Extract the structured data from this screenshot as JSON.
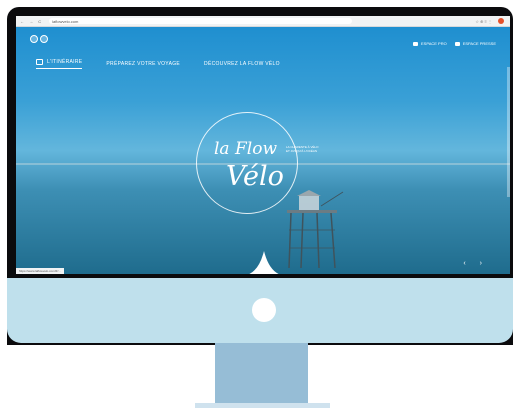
{
  "browser": {
    "url": "laflowvelo.com",
    "nav_glyphs": "← → C",
    "tool_glyphs": "☆ ⊕ ≡ ⋮",
    "status_url": "https://www.laflowvelo.com/fr/..."
  },
  "site": {
    "nav": [
      {
        "label": "L'ITINÉRAIRE"
      },
      {
        "label": "PRÉPAREZ VOTRE VOYAGE"
      },
      {
        "label": "DÉCOUVREZ LA FLOW VÉLO"
      }
    ],
    "buttons": [
      {
        "label": "ESPACE PRO"
      },
      {
        "label": "ESPACE PRESSE"
      }
    ],
    "logo_line1": "la Flow",
    "logo_line2": "Vélo",
    "logo_tagline": "LA CHARENTE À VÉLO ET JUSQU'À L'OCÉAN",
    "slider_arrows": "‹ ›"
  },
  "colors": {
    "sky_top": "#1f8fd0",
    "sea": "#1f6c8d",
    "monitor_chin": "#bfe0ec",
    "stand": "#96bdd6"
  }
}
